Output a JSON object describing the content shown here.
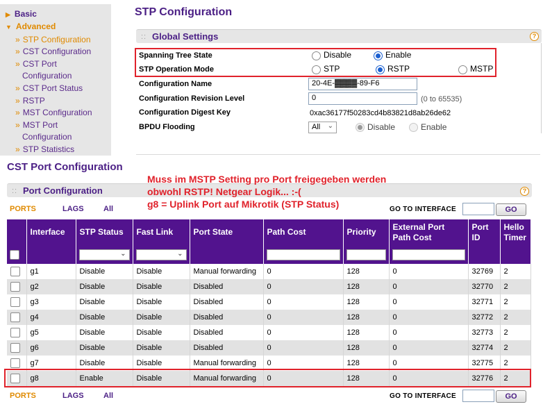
{
  "sidebar": {
    "basic": "Basic",
    "advanced": "Advanced",
    "items": [
      {
        "label": "STP Configuration",
        "active": true
      },
      {
        "label": "CST Configuration"
      },
      {
        "label": "CST Port"
      },
      {
        "label": "Configuration"
      },
      {
        "label": "CST Port Status"
      },
      {
        "label": "RSTP"
      },
      {
        "label": "MST Configuration"
      },
      {
        "label": "MST Port"
      },
      {
        "label": "Configuration"
      },
      {
        "label": "STP Statistics"
      }
    ]
  },
  "page_title": "STP Configuration",
  "global_settings": {
    "title": "Global Settings",
    "help": "?",
    "spanning_tree_state": {
      "label": "Spanning Tree State",
      "options": [
        "Disable",
        "Enable"
      ],
      "selected": "Enable"
    },
    "stp_operation_mode": {
      "label": "STP Operation Mode",
      "options": [
        "STP",
        "RSTP",
        "MSTP"
      ],
      "selected": "RSTP"
    },
    "config_name": {
      "label": "Configuration Name",
      "value": "20-4E-▓▓▓▓-89-F6"
    },
    "revision_level": {
      "label": "Configuration Revision Level",
      "value": "0",
      "hint": "(0 to 65535)"
    },
    "digest_key": {
      "label": "Configuration Digest Key",
      "value": "0xac36177f50283cd4b83821d8ab26de62"
    },
    "bpdu_flooding": {
      "label": "BPDU Flooding",
      "select_value": "All",
      "options": [
        "Disable",
        "Enable"
      ],
      "selected": "Disable"
    }
  },
  "cst_title": "CST Port Configuration",
  "port_config": {
    "title": "Port Configuration",
    "help": "?",
    "tabs": [
      "PORTS",
      "LAGS",
      "All"
    ],
    "goto_label": "GO TO INTERFACE",
    "goto_button": "GO",
    "goto_value": ""
  },
  "annotation": [
    "Muss im MSTP Setting pro Port freigegeben werden",
    "obwohl RSTP! Netgear Logik... :-(",
    "g8 = Uplink Port auf Mikrotik (STP Status)"
  ],
  "table": {
    "columns": [
      "Interface",
      "STP Status",
      "Fast Link",
      "Port State",
      "Path Cost",
      "Priority",
      "External Port Path Cost",
      "Port ID",
      "Hello Timer"
    ],
    "rows": [
      [
        "g1",
        "Disable",
        "Disable",
        "Manual forwarding",
        "0",
        "128",
        "0",
        "32769",
        "2"
      ],
      [
        "g2",
        "Disable",
        "Disable",
        "Disabled",
        "0",
        "128",
        "0",
        "32770",
        "2"
      ],
      [
        "g3",
        "Disable",
        "Disable",
        "Disabled",
        "0",
        "128",
        "0",
        "32771",
        "2"
      ],
      [
        "g4",
        "Disable",
        "Disable",
        "Disabled",
        "0",
        "128",
        "0",
        "32772",
        "2"
      ],
      [
        "g5",
        "Disable",
        "Disable",
        "Disabled",
        "0",
        "128",
        "0",
        "32773",
        "2"
      ],
      [
        "g6",
        "Disable",
        "Disable",
        "Disabled",
        "0",
        "128",
        "0",
        "32774",
        "2"
      ],
      [
        "g7",
        "Disable",
        "Disable",
        "Manual forwarding",
        "0",
        "128",
        "0",
        "32775",
        "2"
      ],
      [
        "g8",
        "Enable",
        "Disable",
        "Manual forwarding",
        "0",
        "128",
        "0",
        "32776",
        "2"
      ]
    ]
  },
  "colors": {
    "accent": "#52138e",
    "orange": "#e08a00",
    "highlight": "#e0222b"
  }
}
